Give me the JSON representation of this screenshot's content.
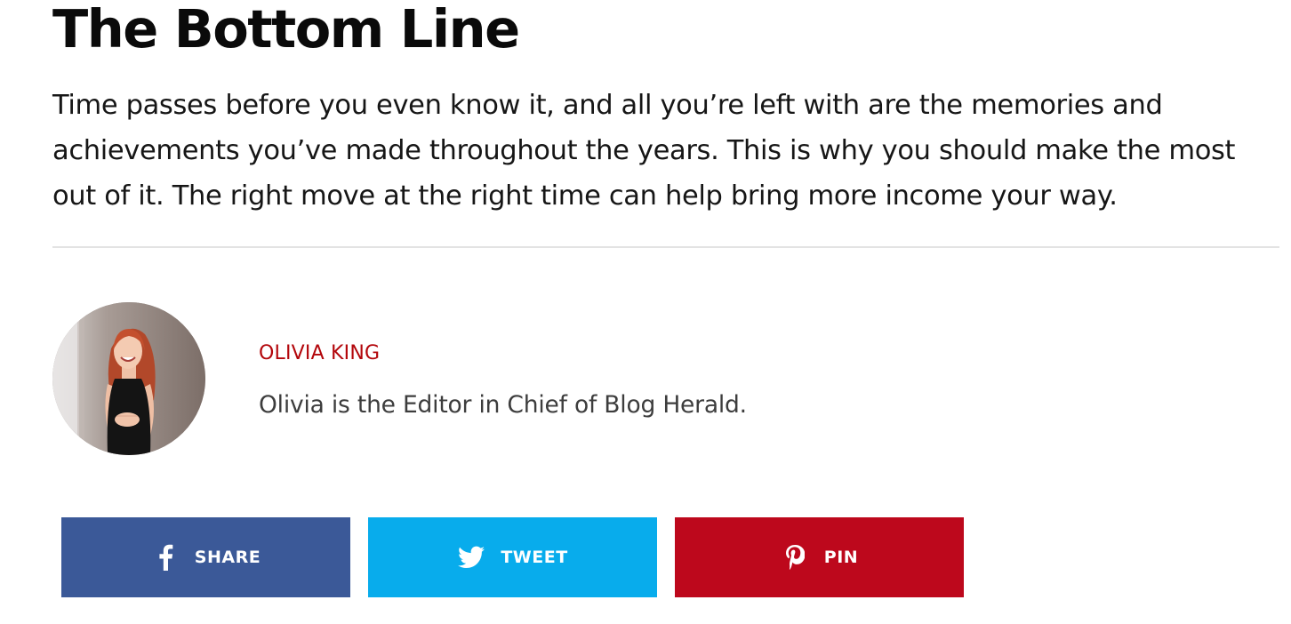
{
  "section": {
    "title": "The Bottom Line",
    "body": "Time passes before you even know it, and all you’re left with are the memories and achievements you’ve made throughout the years. This is why you should make the most out of it. The right move at the right time can help bring more income your way."
  },
  "author": {
    "name": "OLIVIA KING",
    "bio": "Olivia is the Editor in Chief of Blog Herald.",
    "name_color": "#b3060b"
  },
  "share": {
    "facebook": {
      "label": "SHARE",
      "icon": "facebook-icon",
      "color": "#3b5998"
    },
    "twitter": {
      "label": "TWEET",
      "icon": "twitter-icon",
      "color": "#08acec"
    },
    "pinterest": {
      "label": "PIN",
      "icon": "pinterest-icon",
      "color": "#bd081c"
    }
  }
}
